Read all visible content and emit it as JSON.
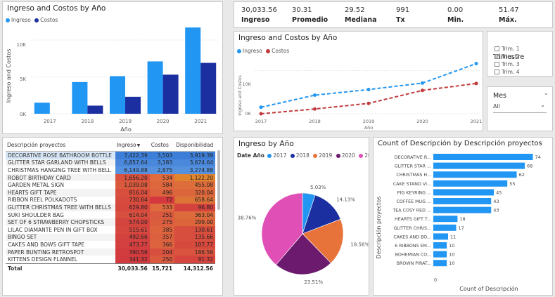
{
  "bar_chart": {
    "title": "Ingreso and Costos by Año",
    "legend": [
      {
        "name": "Ingreso",
        "color": "#2196f3"
      },
      {
        "name": "Costos",
        "color": "#1c2fa0"
      }
    ],
    "ylabel": "Ingreso and Costos",
    "xlabel": "Año",
    "yticks": [
      "0K",
      "5K",
      "10K"
    ],
    "categories": [
      "2017",
      "2018",
      "2019",
      "2020",
      "2021"
    ]
  },
  "kpis": [
    {
      "value": "30,033.56",
      "label": "Ingreso"
    },
    {
      "value": "30.31",
      "label": "Promedio"
    },
    {
      "value": "29.52",
      "label": "Mediana"
    },
    {
      "value": "991",
      "label": "Tx"
    },
    {
      "value": "0.00",
      "label": "Min."
    },
    {
      "value": "51.47",
      "label": "Máx."
    }
  ],
  "line_chart": {
    "title": "Ingreso and Costos by Año",
    "legend": [
      {
        "name": "Ingreso",
        "color": "#2196f3"
      },
      {
        "name": "Costos",
        "color": "#c0393b"
      }
    ],
    "ylabel": "Ingreso and Costos",
    "xlabel": "Año",
    "yticks": [
      "0K",
      "10K"
    ],
    "categories": [
      "2017",
      "2018",
      "2019",
      "2020",
      "2021"
    ]
  },
  "slicer_trimestre": {
    "title": "Trimestre",
    "options": [
      "Trim. 1",
      "Trim. 2",
      "Trim. 3",
      "Trim. 4"
    ]
  },
  "slicer_mes": {
    "title": "Mes",
    "selected": "All"
  },
  "table": {
    "headers": [
      "Descripción proyectos",
      "Ingreso",
      "Costos",
      "Disponibilidad"
    ],
    "rows": [
      [
        "DECORATIVE ROSE BATHROOM BOTTLE",
        "7,422.39",
        "3,503",
        "3,919.39"
      ],
      [
        "GLITTER STAR GARLAND WITH BELLS",
        "6,857.64",
        "3,183",
        "3,674.64"
      ],
      [
        "CHRISTMAS HANGING TREE WITH BELL",
        "6,149.88",
        "2,875",
        "3,274.88"
      ],
      [
        "ROBOT BIRTHDAY CARD",
        "1,656.20",
        "534",
        "1,122.20"
      ],
      [
        "GARDEN METAL SIGN",
        "1,039.08",
        "584",
        "455.08"
      ],
      [
        "HEARTS GIFT TAPE",
        "816.04",
        "496",
        "320.04"
      ],
      [
        "RIBBON REEL POLKADOTS",
        "730.64",
        "72",
        "658.64"
      ],
      [
        "GLITTER CHRISTMAS TREE WITH BELLS",
        "629.80",
        "533",
        "96.80"
      ],
      [
        "SUKI SHOULDER BAG",
        "614.04",
        "251",
        "363.04"
      ],
      [
        "SET OF 6 STRAWBERRY CHOPSTICKS",
        "574.00",
        "275",
        "299.00"
      ],
      [
        "LILAC DIAMANTE PEN IN GIFT BOX",
        "515.61",
        "385",
        "130.61"
      ],
      [
        "BINGO SET",
        "492.66",
        "357",
        "135.66"
      ],
      [
        "CAKES AND BOWS GIFT TAPE",
        "473.77",
        "366",
        "107.77"
      ],
      [
        "PAPER BUNTING RETROSPOT",
        "390.56",
        "204",
        "186.56"
      ],
      [
        "KITTENS DESIGN FLANNEL",
        "341.32",
        "250",
        "91.32"
      ]
    ],
    "total": [
      "Total",
      "30,033.56",
      "15,721",
      "14,312.56"
    ],
    "colors": {
      "ingreso": [
        "#3d7fd8",
        "#4a88dc",
        "#5591df",
        "#d8523f",
        "#da5a3e",
        "#d94f3d",
        "#d74b3e",
        "#d6473e",
        "#d8503f",
        "#d5453f",
        "#d6473f",
        "#d4423f",
        "#d3403f",
        "#d23c3f",
        "#d13a3f"
      ],
      "costos": [
        "#3d7fd8",
        "#4a88dc",
        "#5591df",
        "#df6b3e",
        "#de673d",
        "#dc613d",
        "#d3383f",
        "#df6a3e",
        "#d95a3f",
        "#da5d3e",
        "#dc633e",
        "#db603e",
        "#dc633e",
        "#d7503f",
        "#d95a3f"
      ],
      "disp": [
        "#3d7fd8",
        "#4a88dc",
        "#5591df",
        "#e0842f",
        "#dd6e3c",
        "#dc663c",
        "#de7338",
        "#d4433e",
        "#dd6b3c",
        "#dc653c",
        "#d74d3e",
        "#d74d3e",
        "#d64a3e",
        "#d8543e",
        "#d5453e"
      ]
    }
  },
  "pie_chart": {
    "title": "Ingreso by Año",
    "legend_label": "Date Año",
    "labels": [
      "5.03%",
      "14.13%",
      "18.56%",
      "23.51%",
      "38.76%"
    ]
  },
  "hbar_chart": {
    "title": "Count of Descripción by Descripción proyectos",
    "ylabel": "Descripción proyectos",
    "xlabel": "Count of Descripción",
    "xtick": "0"
  },
  "chart_data": [
    {
      "type": "bar",
      "title": "Ingreso and Costos by Año",
      "xlabel": "Año",
      "ylabel": "Ingreso and Costos",
      "categories": [
        "2017",
        "2018",
        "2019",
        "2020",
        "2021"
      ],
      "series": [
        {
          "name": "Ingreso",
          "values": [
            1500,
            4300,
            5100,
            7100,
            11700
          ],
          "color": "#2196f3"
        },
        {
          "name": "Costos",
          "values": [
            0,
            1100,
            2300,
            5300,
            6900
          ],
          "color": "#1c2fa0"
        }
      ],
      "ylim": [
        0,
        12000
      ]
    },
    {
      "type": "line",
      "title": "Ingreso and Costos by Año",
      "xlabel": "Año",
      "ylabel": "Ingreso and Costos",
      "categories": [
        "2017",
        "2018",
        "2019",
        "2020",
        "2021"
      ],
      "series": [
        {
          "name": "Ingreso",
          "values": [
            1500,
            4300,
            5600,
            7100,
            11600
          ],
          "color": "#2196f3"
        },
        {
          "name": "Costos",
          "values": [
            0,
            1100,
            2400,
            5400,
            7000
          ],
          "color": "#c0393b"
        }
      ],
      "ylim": [
        0,
        13000
      ]
    },
    {
      "type": "pie",
      "title": "Ingreso by Año",
      "categories": [
        "2017",
        "2018",
        "2019",
        "2020",
        "2021"
      ],
      "values": [
        5.03,
        14.13,
        18.56,
        23.51,
        38.76
      ],
      "colors": [
        "#2196f3",
        "#1c2fa0",
        "#e8733a",
        "#6b1a6e",
        "#e04fb6"
      ]
    },
    {
      "type": "bar",
      "orientation": "horizontal",
      "title": "Count of Descripción by Descripción proyectos",
      "xlabel": "Count of Descripción",
      "ylabel": "Descripción proyectos",
      "categories": [
        "DECORATIVE R...",
        "GLITTER STAR ...",
        "CHRISTMAS H...",
        "CAKE STAND VI...",
        "PIG KEYRING ...",
        "COFFEE MUG ...",
        "TEA COSY RED ...",
        "HEARTS GIFT T...",
        "GLITTER CHRIS...",
        "CAKES AND BO...",
        "6 RIBBONS EM...",
        "BOHEMIAN CO...",
        "BROWN PIRAT..."
      ],
      "values": [
        74,
        68,
        62,
        55,
        45,
        43,
        43,
        18,
        17,
        11,
        10,
        10,
        10
      ],
      "xlim": [
        0,
        80
      ],
      "color": "#2196f3"
    }
  ]
}
